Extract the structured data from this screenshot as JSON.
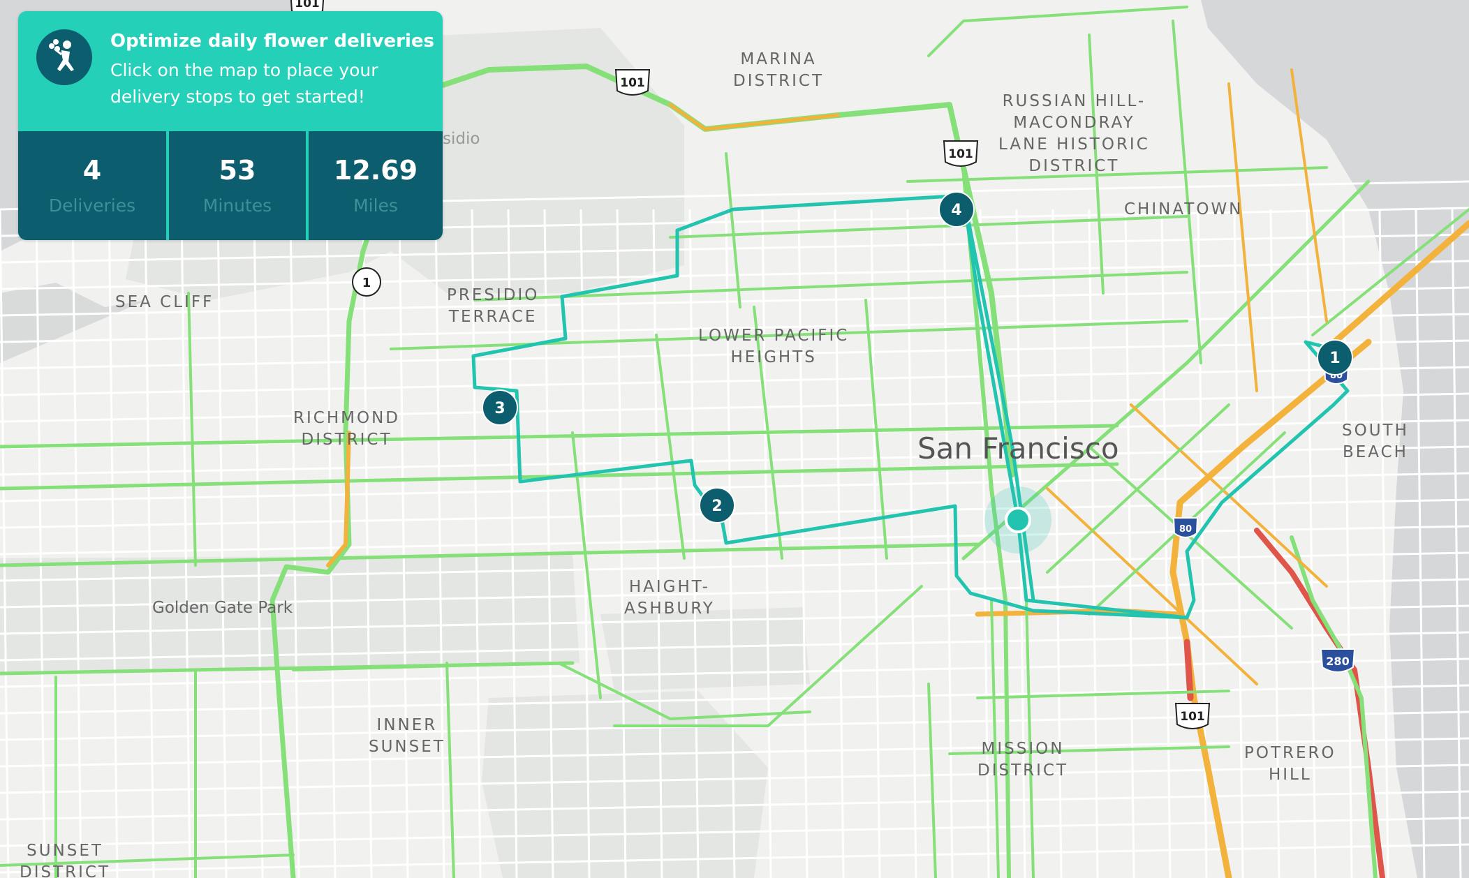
{
  "panel": {
    "title": "Optimize daily flower deliveries",
    "subtitle": "Click on the map to place your delivery stops to get started!",
    "icon": "delivery-person-flowers-icon",
    "accent_color": "#24d0b8",
    "dark_color": "#0c5e6e",
    "stats": [
      {
        "value": "4",
        "label": "Deliveries"
      },
      {
        "value": "53",
        "label": "Minutes"
      },
      {
        "value": "12.69",
        "label": "Miles"
      }
    ]
  },
  "map": {
    "city_label": "San Francisco",
    "park_label": "Golden Gate Park",
    "partial_label": "sidio",
    "neighborhoods": [
      "MARINA\nDISTRICT",
      "RUSSIAN HILL-\nMACONDRAY\nLANE HISTORIC\nDISTRICT",
      "CHINATOWN",
      "PRESIDIO\nTERRACE",
      "SEA CLIFF",
      "LOWER PACIFIC\nHEIGHTS",
      "RICHMOND\nDISTRICT",
      "SOUTH\nBEACH",
      "HAIGHT-\nASHBURY",
      "INNER\nSUNSET",
      "MISSION\nDISTRICT",
      "POTRERO\nHILL",
      "SUNSET\nDISTRICT"
    ],
    "highway_shields": [
      "101",
      "101",
      "101",
      "101",
      "1",
      "80",
      "80",
      "280"
    ],
    "stops": [
      "1",
      "2",
      "3",
      "4"
    ],
    "colors": {
      "route": "#22c4b0",
      "traffic_clear": "#86e07a",
      "traffic_moderate": "#f2b23c",
      "traffic_heavy": "#e0554a",
      "water": "#d5d7d8",
      "park": "#e4e6e3",
      "land": "#f1f1ef"
    }
  }
}
